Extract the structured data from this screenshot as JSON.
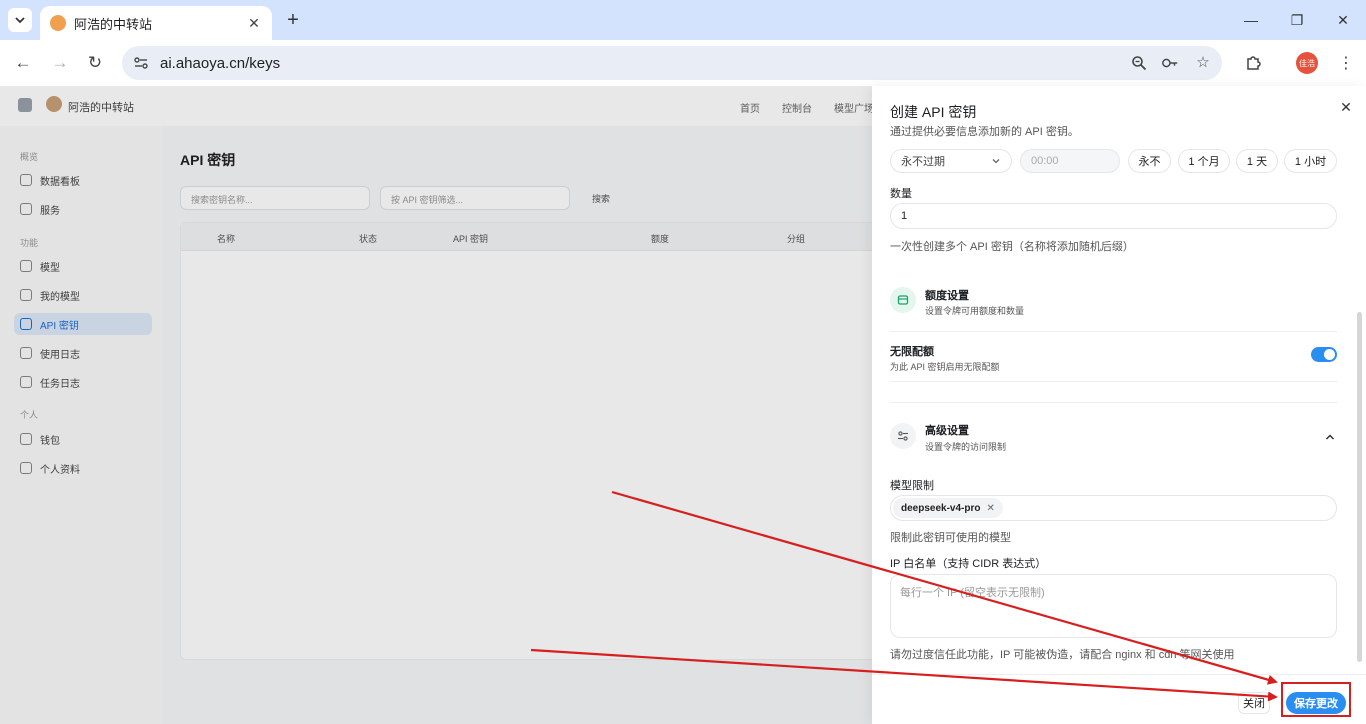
{
  "browser": {
    "tab_title": "阿浩的中转站",
    "url": "ai.ahaoya.cn/keys",
    "profile_label": "佳浩"
  },
  "page": {
    "site_name": "阿浩的中转站",
    "top_nav": [
      "首页",
      "控制台",
      "模型广场"
    ],
    "sidebar_groups": [
      "概览",
      "功能",
      "个人"
    ],
    "sidebar_items": [
      "数据看板",
      "服务",
      "模型",
      "我的模型",
      "API 密钥",
      "使用日志",
      "任务日志",
      "钱包",
      "个人资料"
    ],
    "title": "API 密钥",
    "filter_name_placeholder": "搜索密钥名称...",
    "filter_key_placeholder": "按 API 密钥筛选...",
    "filter_button": "搜索",
    "columns": [
      "名称",
      "状态",
      "API 密钥",
      "额度",
      "分组"
    ]
  },
  "drawer": {
    "title": "创建 API 密钥",
    "subtitle": "通过提供必要信息添加新的 API 密钥。",
    "expire_select": "永不过期",
    "time_placeholder": "00:00",
    "quick_expire": [
      "永不",
      "1 个月",
      "1 天",
      "1 小时"
    ],
    "quantity_label": "数量",
    "quantity_value": "1",
    "quantity_hint": "一次性创建多个 API 密钥（名称将添加随机后缀）",
    "quota_section_title": "额度设置",
    "quota_section_sub": "设置令牌可用额度和数量",
    "unlimited_label": "无限配额",
    "unlimited_sub": "为此 API 密钥启用无限配额",
    "unlimited_enabled": true,
    "advanced_section_title": "高级设置",
    "advanced_section_sub": "设置令牌的访问限制",
    "model_limit_label": "模型限制",
    "model_tag": "deepseek-v4-pro",
    "model_limit_hint": "限制此密钥可使用的模型",
    "ip_label": "IP 白名单（支持 CIDR 表达式）",
    "ip_placeholder": "每行一个 IP (留空表示无限制)",
    "ip_hint": "请勿过度信任此功能，IP 可能被伪造，请配合 nginx 和 cdn 等网关使用",
    "close_button": "关闭",
    "save_button": "保存更改"
  },
  "colors": {
    "accent": "#2a8ef0",
    "annotation": "#d71f1f",
    "tabbar": "#d3e3fd"
  }
}
